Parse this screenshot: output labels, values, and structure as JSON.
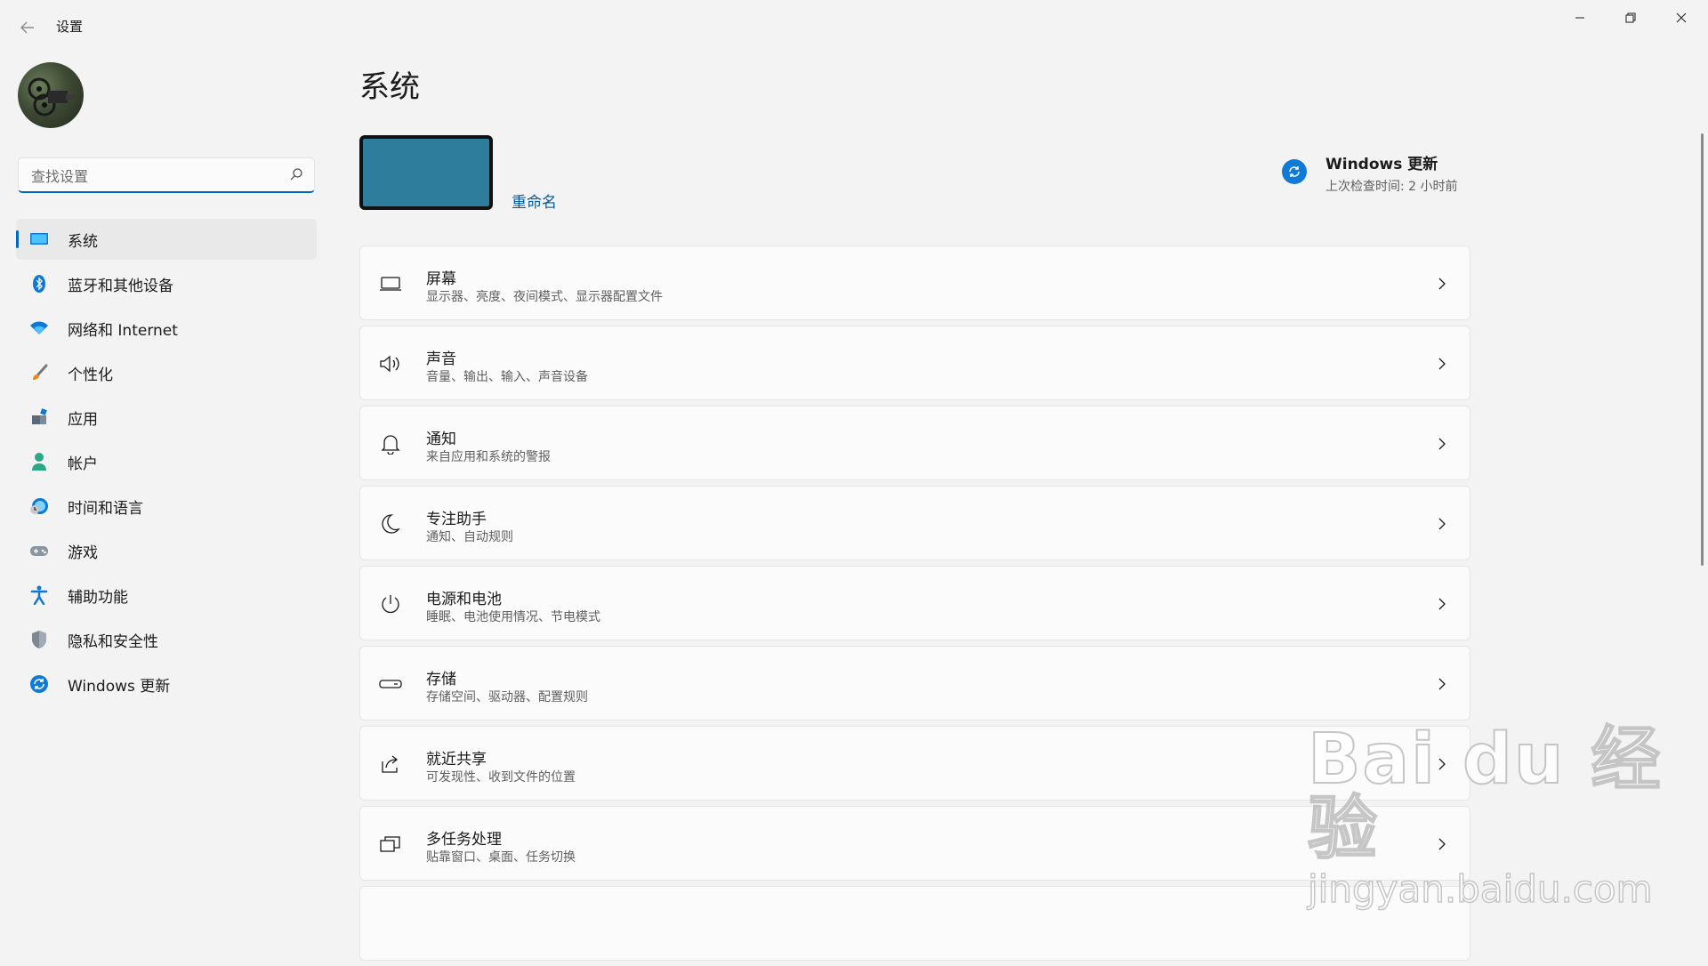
{
  "window": {
    "title": "设置",
    "min_icon": "minimize-icon",
    "max_icon": "restore-icon",
    "close_icon": "close-icon"
  },
  "sidebar": {
    "search_placeholder": "查找设置",
    "items": [
      {
        "label": "系统",
        "icon": "system-icon",
        "active": true
      },
      {
        "label": "蓝牙和其他设备",
        "icon": "bluetooth-icon"
      },
      {
        "label": "网络和 Internet",
        "icon": "wifi-icon"
      },
      {
        "label": "个性化",
        "icon": "brush-icon"
      },
      {
        "label": "应用",
        "icon": "apps-icon"
      },
      {
        "label": "帐户",
        "icon": "account-icon"
      },
      {
        "label": "时间和语言",
        "icon": "time-language-icon"
      },
      {
        "label": "游戏",
        "icon": "gamepad-icon"
      },
      {
        "label": "辅助功能",
        "icon": "accessibility-icon"
      },
      {
        "label": "隐私和安全性",
        "icon": "shield-icon"
      },
      {
        "label": "Windows 更新",
        "icon": "windows-update-icon"
      }
    ]
  },
  "main": {
    "title": "系统",
    "rename_label": "重命名",
    "update": {
      "title": "Windows 更新",
      "subtitle": "上次检查时间: 2 小时前"
    },
    "cards": [
      {
        "title": "屏幕",
        "subtitle": "显示器、亮度、夜间模式、显示器配置文件",
        "icon": "display-icon"
      },
      {
        "title": "声音",
        "subtitle": "音量、输出、输入、声音设备",
        "icon": "speaker-icon"
      },
      {
        "title": "通知",
        "subtitle": "来自应用和系统的警报",
        "icon": "bell-icon"
      },
      {
        "title": "专注助手",
        "subtitle": "通知、自动规则",
        "icon": "moon-icon"
      },
      {
        "title": "电源和电池",
        "subtitle": "睡眠、电池使用情况、节电模式",
        "icon": "power-icon"
      },
      {
        "title": "存储",
        "subtitle": "存储空间、驱动器、配置规则",
        "icon": "storage-icon"
      },
      {
        "title": "就近共享",
        "subtitle": "可发现性、收到文件的位置",
        "icon": "share-icon"
      },
      {
        "title": "多任务处理",
        "subtitle": "贴靠窗口、桌面、任务切换",
        "icon": "multitask-icon"
      }
    ]
  },
  "watermark": {
    "brand": "Bai du 经验",
    "url": "jingyan.baidu.com"
  },
  "colors": {
    "accent": "#0067c0",
    "background": "#f3f3f3",
    "card": "#fbfbfb",
    "device": "#2e7d9c",
    "link": "#005a9e"
  }
}
